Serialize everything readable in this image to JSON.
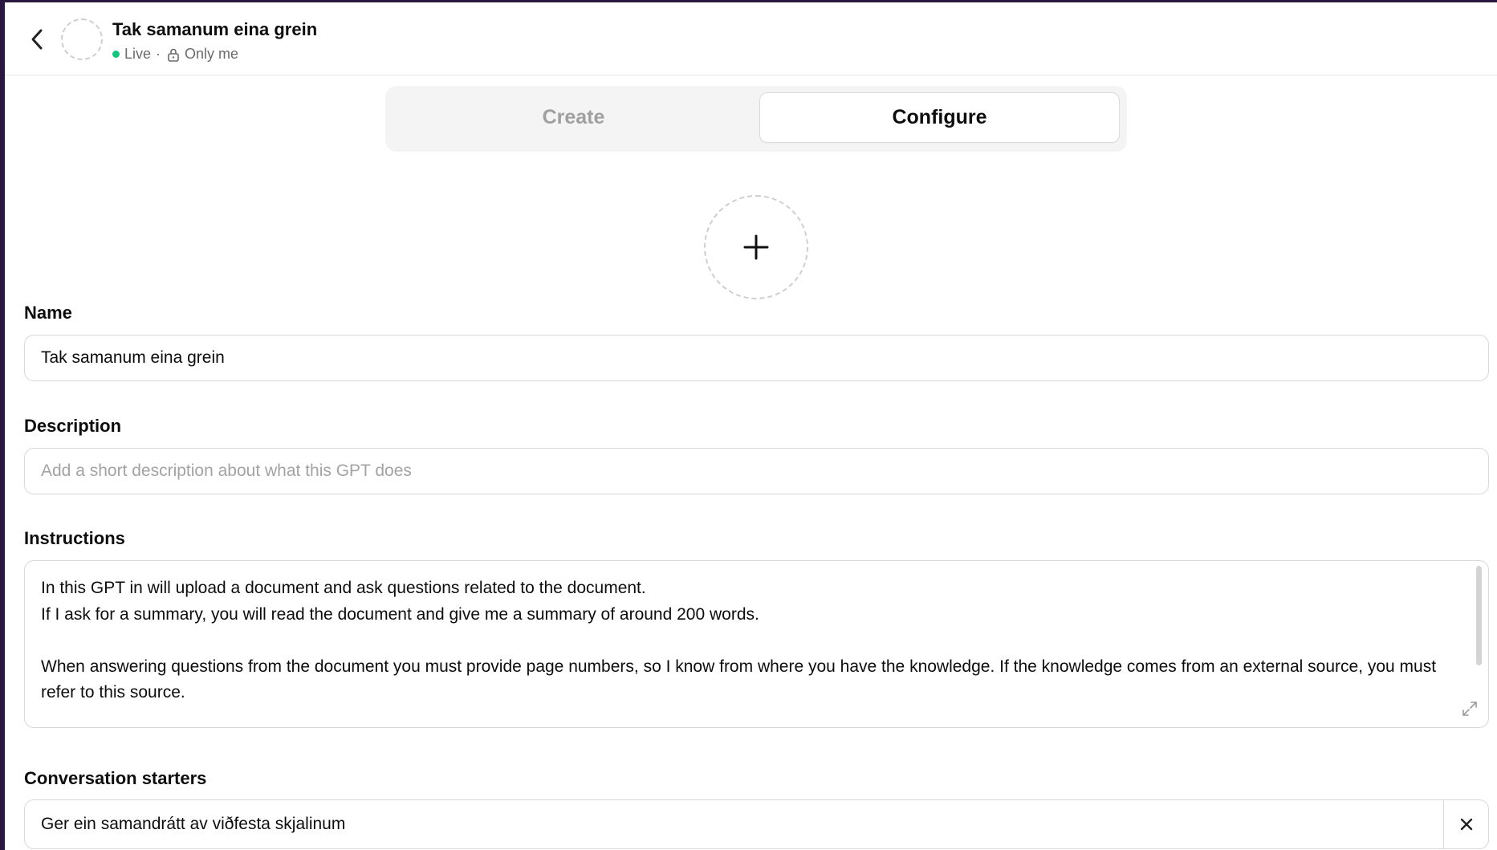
{
  "header": {
    "title": "Tak samanum eina grein",
    "status_live": "Live",
    "status_separator": "·",
    "visibility": "Only me"
  },
  "tabs": [
    {
      "label": "Create",
      "active": false
    },
    {
      "label": "Configure",
      "active": true
    }
  ],
  "form": {
    "name": {
      "label": "Name",
      "value": "Tak samanum eina grein"
    },
    "description": {
      "label": "Description",
      "value": "",
      "placeholder": "Add a short description about what this GPT does"
    },
    "instructions": {
      "label": "Instructions",
      "value": "In this GPT in will upload a document and ask questions related to the document.\nIf I ask for a summary, you will read the document and give me a summary of around 200 words.\n\nWhen answering questions from the document you must provide page numbers, so I know from where you have the knowledge. If the knowledge comes from an external source, you must refer to this source."
    },
    "conversation_starters": {
      "label": "Conversation starters",
      "items": [
        "Ger ein samandrátt av viðfesta skjalinum"
      ]
    }
  },
  "colors": {
    "accent_live": "#19c37d",
    "muted_text": "#a0a0a0",
    "border": "#d9d9d9"
  },
  "icons": {
    "back": "chevron-left-icon",
    "lock": "lock-icon",
    "add": "plus-icon",
    "expand": "expand-icon",
    "remove": "close-icon"
  }
}
